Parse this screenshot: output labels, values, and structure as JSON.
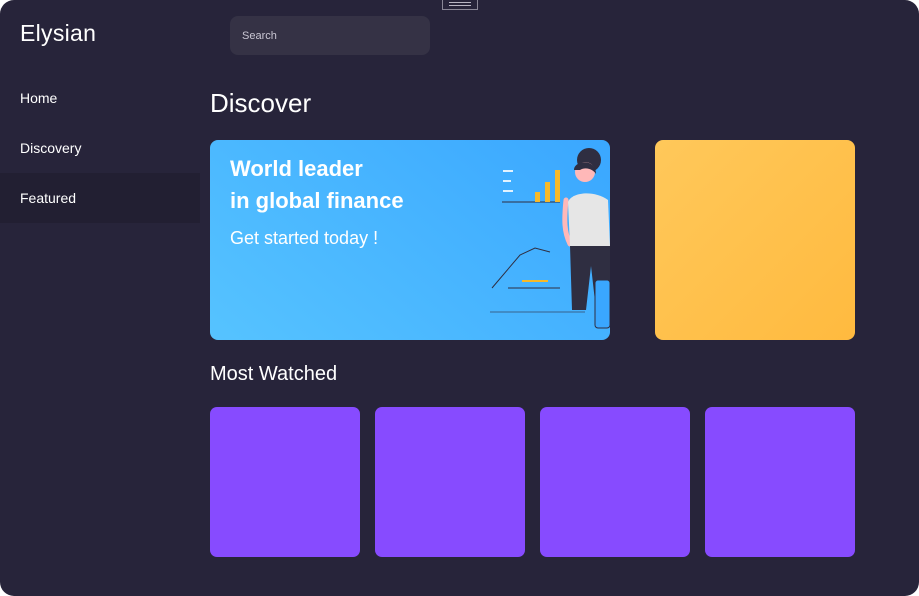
{
  "app": {
    "brand": "Elysian"
  },
  "search": {
    "placeholder": "Search",
    "value": ""
  },
  "sidebar": {
    "items": [
      {
        "label": "Home",
        "active": false
      },
      {
        "label": "Discovery",
        "active": false
      },
      {
        "label": "Featured",
        "active": true
      }
    ]
  },
  "main": {
    "title": "Discover",
    "hero": {
      "title_line1": "World leader",
      "title_line2": "in global finance",
      "subtitle": "Get started today !"
    },
    "most_watched": {
      "title": "Most Watched",
      "tile_count": 4
    }
  },
  "colors": {
    "background": "#27243a",
    "sidebar_active": "#221f32",
    "hero_blue": "#3aa7ff",
    "feature_yellow": "#ffc04d",
    "tile_purple": "#874bff",
    "chart_yellow": "#f7b928",
    "person_skin": "#ffb8b8",
    "person_hair": "#2f2e41"
  }
}
